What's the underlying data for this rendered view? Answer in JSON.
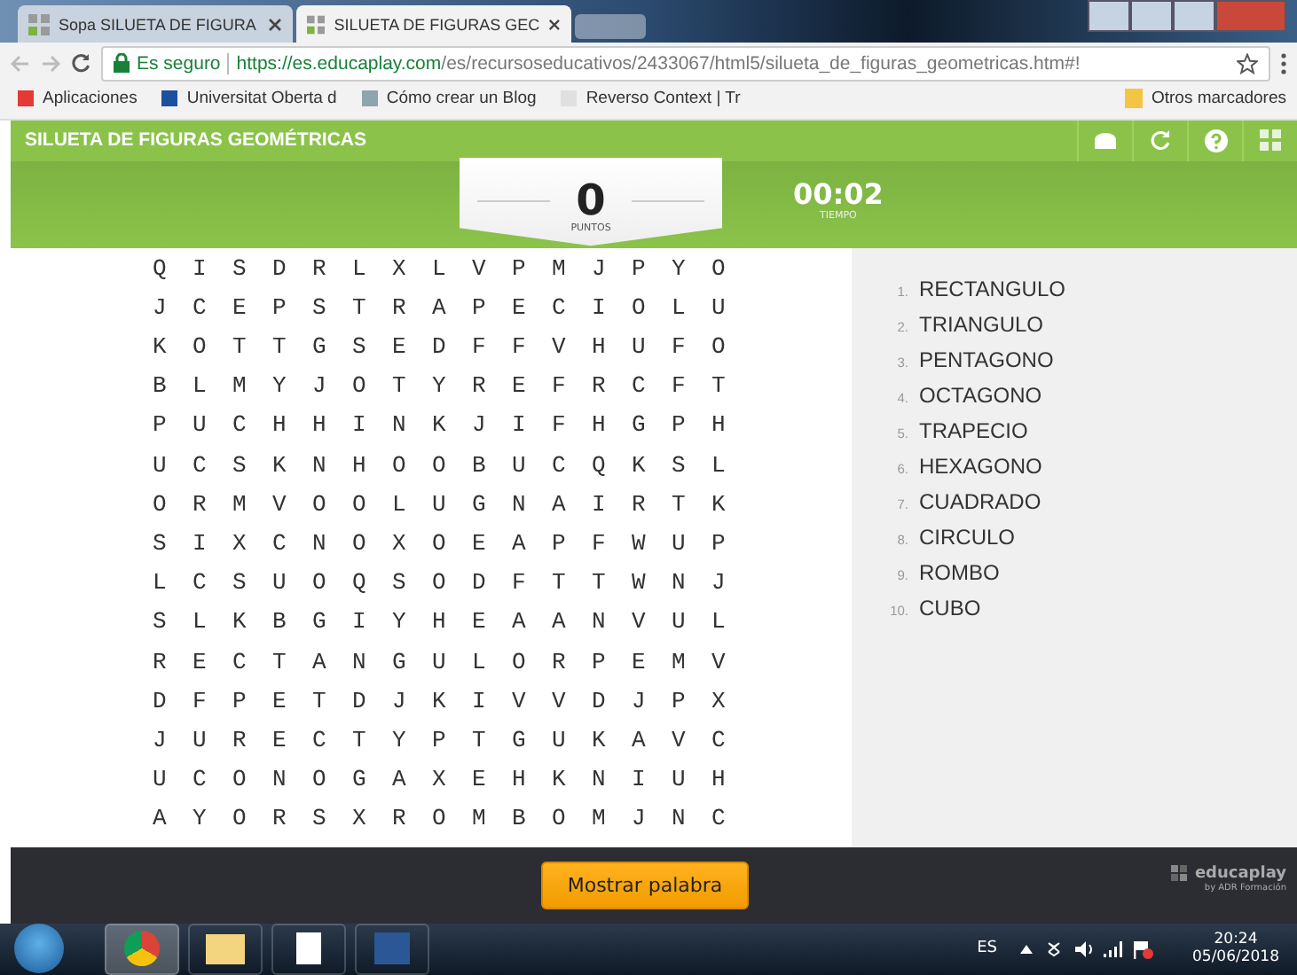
{
  "browser": {
    "tabs": [
      {
        "label": "Sopa SILUETA DE FIGURA",
        "selected": false
      },
      {
        "label": "SILUETA DE FIGURAS GEC",
        "selected": true
      }
    ],
    "security": "Es seguro",
    "url_host": "https://es.educaplay.com",
    "url_path": "/es/recursoseducativos/2433067/html5/silueta_de_figuras_geometricas.htm#!",
    "bookmarks": [
      "Aplicaciones",
      "Universitat Oberta d",
      "Cómo crear un Blog",
      "Reverso Context | Tr"
    ],
    "other_bookmarks": "Otros marcadores"
  },
  "game": {
    "title": "SILUETA DE FIGURAS GEOMÉTRICAS",
    "score": "0",
    "score_label": "PUNTOS",
    "time": "00:02",
    "time_label": "TIEMPO",
    "grid": [
      "Q I S D R L X L V P M J P Y O",
      "J C E P S T R A P E C I O L U",
      "K O T T G S E D F F V H U F O",
      "B L M Y J O T Y R E F R C F T",
      "P U C H H I N K J I F H G P H",
      "U C S K N H O O B U C Q K S L",
      "O R M V O O L U G N A I R T K",
      "S I X C N O X O E A P F W U P",
      "L C S U O Q S O D F T T W N J",
      "S L K B G I Y H E A A N V U L",
      "R E C T A N G U L O R P E M V",
      "D F P E T D J K I V V D J P X",
      "J U R E C T Y P T G U K A V C",
      "U C O N O G A X E H K N I U H",
      "A Y O R S X R O M B O M J N C"
    ],
    "words": [
      {
        "number": "1.",
        "word": "RECTANGULO"
      },
      {
        "number": "2.",
        "word": "TRIANGULO"
      },
      {
        "number": "3.",
        "word": "PENTAGONO"
      },
      {
        "number": "4.",
        "word": "OCTAGONO"
      },
      {
        "number": "5.",
        "word": "TRAPECIO"
      },
      {
        "number": "6.",
        "word": "HEXAGONO"
      },
      {
        "number": "7.",
        "word": "CUADRADO"
      },
      {
        "number": "8.",
        "word": "CIRCULO"
      },
      {
        "number": "9.",
        "word": "ROMBO"
      },
      {
        "number": "10.",
        "word": "CUBO"
      }
    ],
    "show_word_button": "Mostrar palabra",
    "brand": "educaplay",
    "brand_sub": "by ADR Formación"
  },
  "taskbar": {
    "language": "ES",
    "time": "20:24",
    "date": "05/06/2018"
  }
}
